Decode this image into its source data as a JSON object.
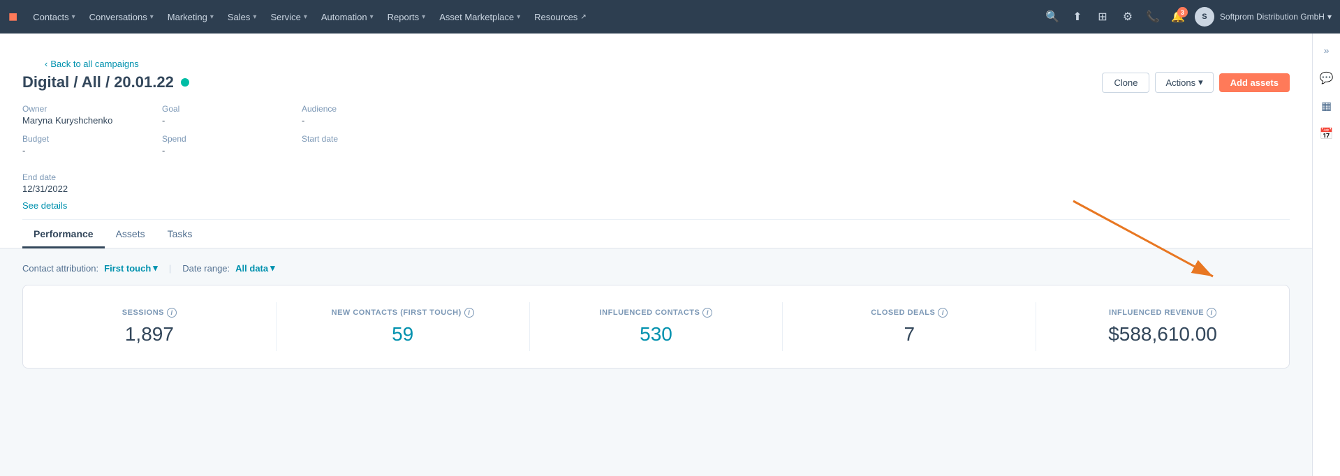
{
  "topnav": {
    "logo": "🔶",
    "items": [
      {
        "label": "Contacts",
        "hasChevron": true
      },
      {
        "label": "Conversations",
        "hasChevron": true
      },
      {
        "label": "Marketing",
        "hasChevron": true
      },
      {
        "label": "Sales",
        "hasChevron": true
      },
      {
        "label": "Service",
        "hasChevron": true
      },
      {
        "label": "Automation",
        "hasChevron": true
      },
      {
        "label": "Reports",
        "hasChevron": true
      },
      {
        "label": "Asset Marketplace",
        "hasChevron": true
      },
      {
        "label": "Resources",
        "hasExt": true
      }
    ],
    "notif_count": "3",
    "account_name": "Softprom Distribution GmbH"
  },
  "back_link": "Back to all campaigns",
  "campaign": {
    "title": "Digital / All / 20.01.22",
    "status": "active",
    "owner_label": "Owner",
    "owner_value": "Maryna Kuryshchenko",
    "goal_label": "Goal",
    "goal_value": "-",
    "audience_label": "Audience",
    "audience_value": "-",
    "budget_label": "Budget",
    "budget_value": "-",
    "spend_label": "Spend",
    "spend_value": "-",
    "start_date_label": "Start date",
    "start_date_value": "",
    "end_date_label": "End date",
    "end_date_value": "12/31/2022",
    "see_details": "See details"
  },
  "buttons": {
    "clone": "Clone",
    "actions": "Actions",
    "add_assets": "Add assets"
  },
  "tabs": [
    {
      "label": "Performance",
      "active": true
    },
    {
      "label": "Assets",
      "active": false
    },
    {
      "label": "Tasks",
      "active": false
    }
  ],
  "filters": {
    "contact_attribution_label": "Contact attribution:",
    "contact_attribution_value": "First touch",
    "date_range_label": "Date range:",
    "date_range_value": "All data"
  },
  "stats": [
    {
      "label": "Sessions",
      "value": "1,897",
      "highlight": false
    },
    {
      "label": "New Contacts (First Touch)",
      "value": "59",
      "highlight": true
    },
    {
      "label": "Influenced Contacts",
      "value": "530",
      "highlight": true
    },
    {
      "label": "Closed Deals",
      "value": "7",
      "highlight": false
    },
    {
      "label": "Influenced Revenue",
      "value": "$588,610.00",
      "highlight": false
    }
  ]
}
